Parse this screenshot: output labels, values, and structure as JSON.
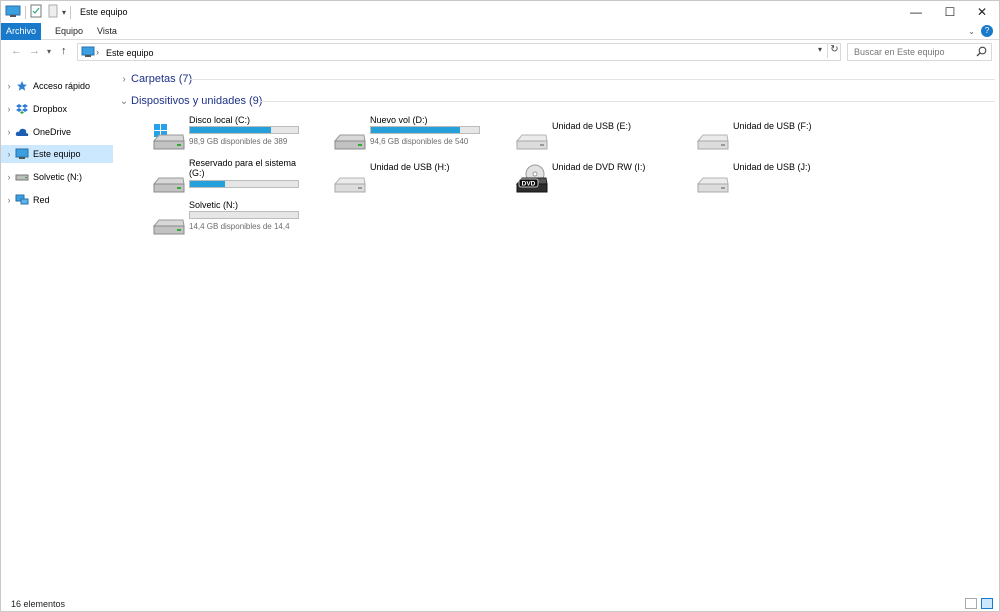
{
  "window": {
    "title": "Este equipo",
    "minimize": "—",
    "maximize": "☐",
    "close": "✕"
  },
  "ribbon": {
    "tabs": [
      "Archivo",
      "Equipo",
      "Vista"
    ],
    "help": "?",
    "expand": "⌄"
  },
  "address": {
    "back": "←",
    "forward": "→",
    "dropdown": "▾",
    "up": "↑",
    "crumb": "Este equipo",
    "separator": "›",
    "refresh": "↻"
  },
  "search": {
    "placeholder": "Buscar en Este equipo"
  },
  "nav": [
    {
      "label": "Acceso rápido",
      "icon": "star-icon",
      "selected": false
    },
    {
      "label": "Dropbox",
      "icon": "dropbox-icon",
      "selected": false
    },
    {
      "label": "OneDrive",
      "icon": "cloud-icon",
      "selected": false
    },
    {
      "label": "Este equipo",
      "icon": "computer-icon",
      "selected": true
    },
    {
      "label": "Solvetic (N:)",
      "icon": "drive-icon",
      "selected": false
    },
    {
      "label": "Red",
      "icon": "network-icon",
      "selected": false
    }
  ],
  "groups": {
    "folders": {
      "label": "Carpetas (7)",
      "chevron": "›"
    },
    "devices": {
      "label": "Dispositivos y unidades (9)",
      "chevron": "⌄"
    }
  },
  "drives": [
    {
      "name": "Disco local (C:)",
      "free": "98,9 GB disponibles de 389",
      "used_fraction": 0.75,
      "icon": "windows-drive-icon"
    },
    {
      "name": "Nuevo vol (D:)",
      "free": "94,6 GB disponibles de 540",
      "used_fraction": 0.82,
      "icon": "hard-drive-icon"
    },
    {
      "name": "Unidad de USB (E:)",
      "icon": "usb-drive-icon"
    },
    {
      "name": "Unidad de USB (F:)",
      "icon": "usb-drive-icon"
    },
    {
      "name": "Reservado para el sistema (G:)",
      "used_fraction": 0.32,
      "icon": "hard-drive-icon"
    },
    {
      "name": "Unidad de USB (H:)",
      "icon": "usb-drive-icon"
    },
    {
      "name": "Unidad de DVD RW (I:)",
      "icon": "dvd-drive-icon",
      "badge": "DVD"
    },
    {
      "name": "Unidad de USB (J:)",
      "icon": "usb-drive-icon"
    },
    {
      "name": "Solvetic (N:)",
      "free": "14,4 GB disponibles de 14,4",
      "used_fraction": 0.0,
      "icon": "hard-drive-icon"
    }
  ],
  "status": {
    "count": "16 elementos"
  },
  "colors": {
    "accent": "#1979ca",
    "bar_fill": "#26a0da",
    "group_header": "#1e3287",
    "selected_bg": "#cce8ff"
  }
}
